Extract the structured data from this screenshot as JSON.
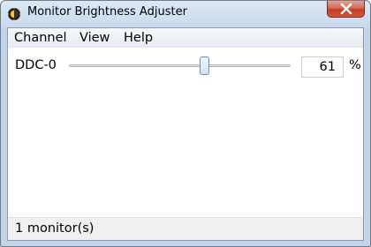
{
  "window": {
    "title": "Monitor Brightness Adjuster"
  },
  "menu": {
    "items": [
      "Channel",
      "View",
      "Help"
    ]
  },
  "monitors": [
    {
      "label": "DDC-0",
      "brightness_value": "61",
      "unit": "%",
      "slider_fraction": 0.61
    }
  ],
  "status": {
    "text": "1 monitor(s)"
  },
  "icons": {
    "app": "monitor-brightness-icon",
    "close": "close-icon"
  },
  "colors": {
    "close_button": "#c23d25",
    "titlebar": "#c9d9ee"
  }
}
